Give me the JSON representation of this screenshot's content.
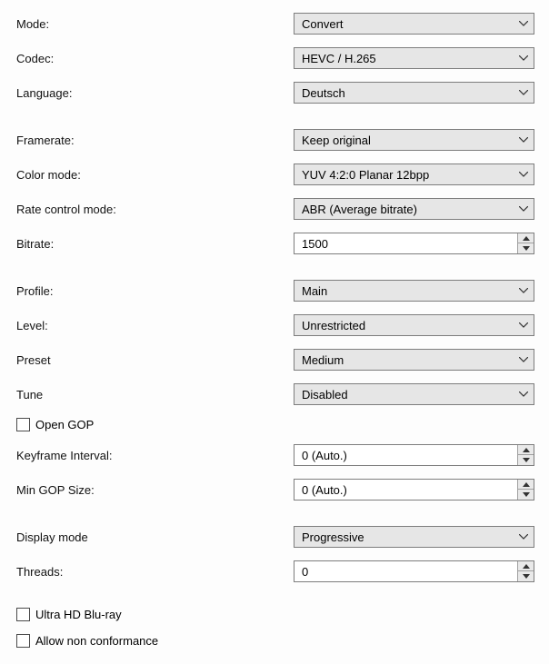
{
  "mode": {
    "label": "Mode:",
    "value": "Convert"
  },
  "codec": {
    "label": "Codec:",
    "value": "HEVC / H.265"
  },
  "language": {
    "label": "Language:",
    "value": "Deutsch"
  },
  "framerate": {
    "label": "Framerate:",
    "value": "Keep original"
  },
  "color_mode": {
    "label": "Color mode:",
    "value": "YUV 4:2:0 Planar 12bpp"
  },
  "rate_control": {
    "label": "Rate control mode:",
    "value": "ABR (Average bitrate)"
  },
  "bitrate": {
    "label": "Bitrate:",
    "value": "1500"
  },
  "profile": {
    "label": "Profile:",
    "value": "Main"
  },
  "level": {
    "label": "Level:",
    "value": "Unrestricted"
  },
  "preset": {
    "label": "Preset",
    "value": "Medium"
  },
  "tune": {
    "label": "Tune",
    "value": "Disabled"
  },
  "open_gop": {
    "label": "Open GOP",
    "checked": false
  },
  "keyframe_interval": {
    "label": "Keyframe Interval:",
    "value": "0 (Auto.)"
  },
  "min_gop_size": {
    "label": "Min GOP Size:",
    "value": "0 (Auto.)"
  },
  "display_mode": {
    "label": "Display mode",
    "value": "Progressive"
  },
  "threads": {
    "label": "Threads:",
    "value": "0"
  },
  "uhd_bluray": {
    "label": "Ultra HD Blu-ray",
    "checked": false
  },
  "allow_nonconf": {
    "label": "Allow non conformance",
    "checked": false
  }
}
